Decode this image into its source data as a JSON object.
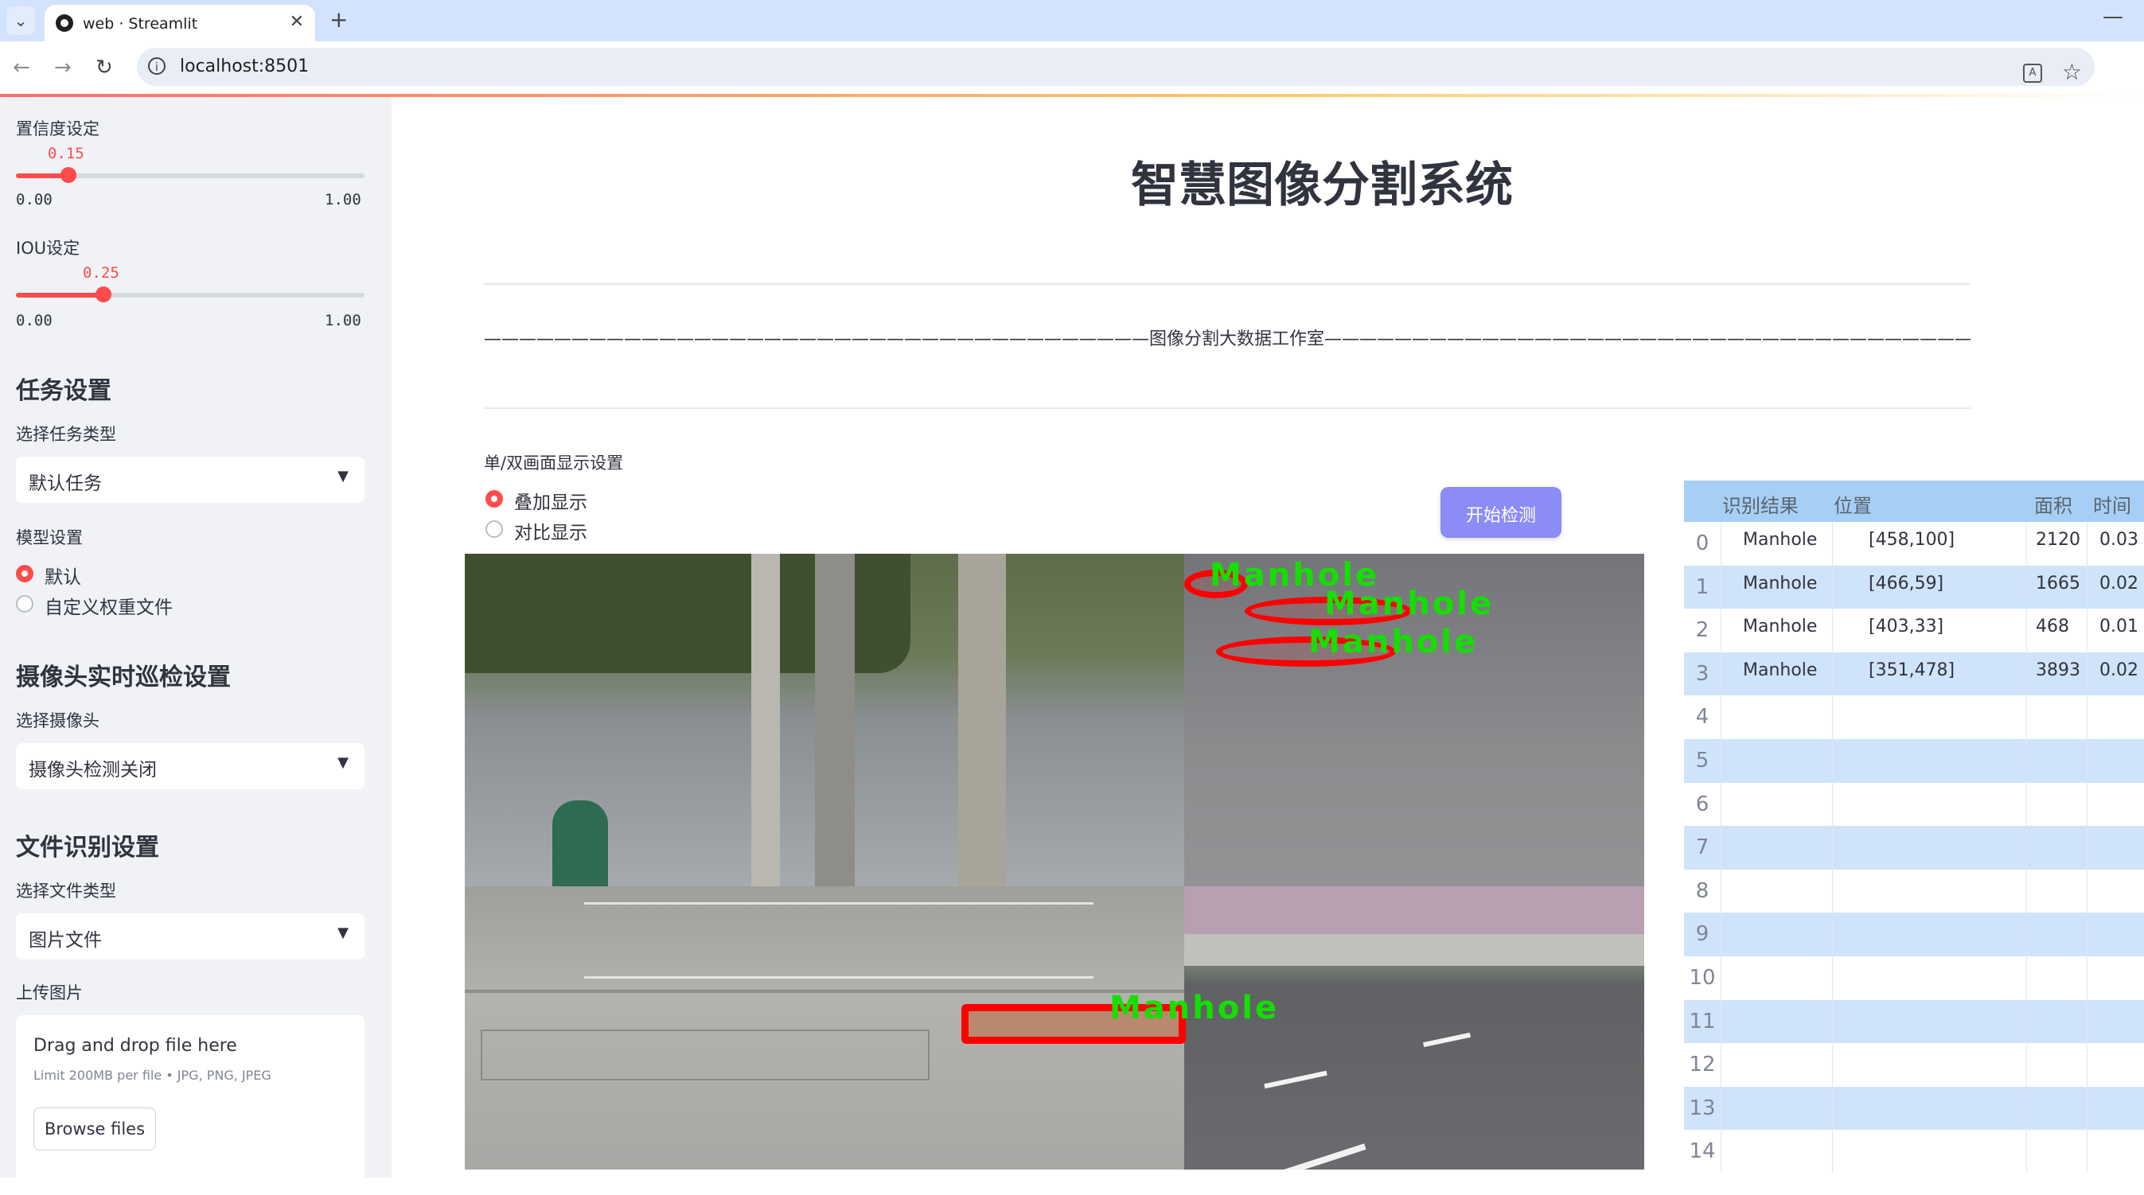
{
  "browser": {
    "tab_title": "web · Streamlit",
    "url": "localhost:8501"
  },
  "sidebar": {
    "confidence": {
      "label": "置信度设定",
      "value_text": "0.15",
      "value": 0.15,
      "min": "0.00",
      "max": "1.00"
    },
    "iou": {
      "label": "IOU设定",
      "value_text": "0.25",
      "value": 0.25,
      "min": "0.00",
      "max": "1.00"
    },
    "task_section": {
      "title": "任务设置",
      "select_label": "选择任务类型",
      "selected": "默认任务"
    },
    "model_section": {
      "label": "模型设置",
      "options": [
        "默认",
        "自定义权重文件"
      ],
      "selected_index": 0
    },
    "camera_section": {
      "title": "摄像头实时巡检设置",
      "select_label": "选择摄像头",
      "selected": "摄像头检测关闭"
    },
    "file_section": {
      "title": "文件识别设置",
      "select_label": "选择文件类型",
      "selected": "图片文件"
    },
    "upload": {
      "label": "上传图片",
      "drop_text": "Drag and drop file here",
      "limit_text": "Limit 200MB per file • JPG, PNG, JPEG",
      "browse_label": "Browse files"
    }
  },
  "main": {
    "title": "智慧图像分割系统",
    "studio_text": "——————————————————————————————————————图像分割大数据工作室——————————————————————————————————————",
    "display_mode": {
      "label": "单/双画面显示设置",
      "options": [
        "叠加显示",
        "对比显示"
      ],
      "selected_index": 0
    },
    "start_button": "开始检测",
    "detection_label": "Manhole"
  },
  "results_table": {
    "headers": [
      "识别结果",
      "位置",
      "面积",
      "时间"
    ],
    "rows": [
      {
        "idx": "0",
        "result": "Manhole",
        "position": "[458,100]",
        "area": "2120",
        "time": "0.03"
      },
      {
        "idx": "1",
        "result": "Manhole",
        "position": "[466,59]",
        "area": "1665",
        "time": "0.02"
      },
      {
        "idx": "2",
        "result": "Manhole",
        "position": "[403,33]",
        "area": "468",
        "time": "0.01"
      },
      {
        "idx": "3",
        "result": "Manhole",
        "position": "[351,478]",
        "area": "3893",
        "time": "0.02"
      },
      {
        "idx": "4",
        "result": "",
        "position": "",
        "area": "",
        "time": ""
      },
      {
        "idx": "5",
        "result": "",
        "position": "",
        "area": "",
        "time": ""
      },
      {
        "idx": "6",
        "result": "",
        "position": "",
        "area": "",
        "time": ""
      },
      {
        "idx": "7",
        "result": "",
        "position": "",
        "area": "",
        "time": ""
      },
      {
        "idx": "8",
        "result": "",
        "position": "",
        "area": "",
        "time": ""
      },
      {
        "idx": "9",
        "result": "",
        "position": "",
        "area": "",
        "time": ""
      },
      {
        "idx": "10",
        "result": "",
        "position": "",
        "area": "",
        "time": ""
      },
      {
        "idx": "11",
        "result": "",
        "position": "",
        "area": "",
        "time": ""
      },
      {
        "idx": "12",
        "result": "",
        "position": "",
        "area": "",
        "time": ""
      },
      {
        "idx": "13",
        "result": "",
        "position": "",
        "area": "",
        "time": ""
      },
      {
        "idx": "14",
        "result": "",
        "position": "",
        "area": "",
        "time": ""
      }
    ]
  },
  "colors": {
    "accent": "#ff4b4b",
    "sidebar_bg": "#f0f2f6",
    "button_bg": "#8b8cf5",
    "table_stripe": "#cfe4fa",
    "mask": "#ff0000",
    "label": "#13e000"
  }
}
